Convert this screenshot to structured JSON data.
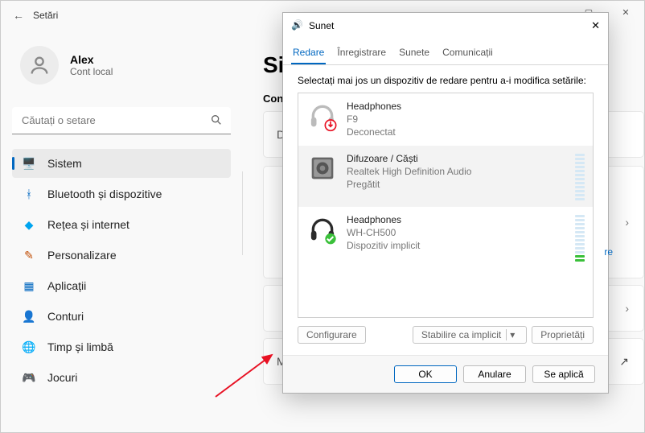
{
  "titlebar": {
    "title": "Setări"
  },
  "user": {
    "name": "Alex",
    "sub": "Cont local"
  },
  "search": {
    "placeholder": "Căutați o setare"
  },
  "nav": [
    {
      "label": "Sistem",
      "icon": "🖥️",
      "color": "#0067c0"
    },
    {
      "label": "Bluetooth și dispozitive",
      "icon": "ᚼ",
      "color": "#0067c0"
    },
    {
      "label": "Rețea și internet",
      "icon": "◆",
      "color": "#00a4ef"
    },
    {
      "label": "Personalizare",
      "icon": "✎",
      "color": "#c04b00"
    },
    {
      "label": "Aplicații",
      "icon": "▦",
      "color": "#0067c0"
    },
    {
      "label": "Conturi",
      "icon": "👤",
      "color": "#666"
    },
    {
      "label": "Timp și limbă",
      "icon": "🌐",
      "color": "#333"
    },
    {
      "label": "Jocuri",
      "icon": "🎮",
      "color": "#888"
    }
  ],
  "main": {
    "page_title": "Si",
    "section_label": "Con",
    "card1": "D",
    "card_more": "Mai multe setări de sunet"
  },
  "dialog": {
    "title": "Sunet",
    "tabs": [
      "Redare",
      "Înregistrare",
      "Sunete",
      "Comunicații"
    ],
    "selected_tab": 0,
    "instruction": "Selectați mai jos un dispozitiv de redare pentru a-i modifica setările:",
    "devices": [
      {
        "name": "Headphones",
        "sub1": "F9",
        "sub2": "Deconectat",
        "status": "disconnected"
      },
      {
        "name": "Difuzoare / Căști",
        "sub1": "Realtek High Definition Audio",
        "sub2": "Pregătit",
        "status": "ready",
        "selected": true
      },
      {
        "name": "Headphones",
        "sub1": "WH-CH500",
        "sub2": "Dispozitiv implicit",
        "status": "default"
      }
    ],
    "actions": {
      "configure": "Configurare",
      "set_default": "Stabilire ca implicit",
      "properties": "Proprietăți"
    },
    "footer": {
      "ok": "OK",
      "cancel": "Anulare",
      "apply": "Se aplică"
    },
    "peek": "re"
  }
}
